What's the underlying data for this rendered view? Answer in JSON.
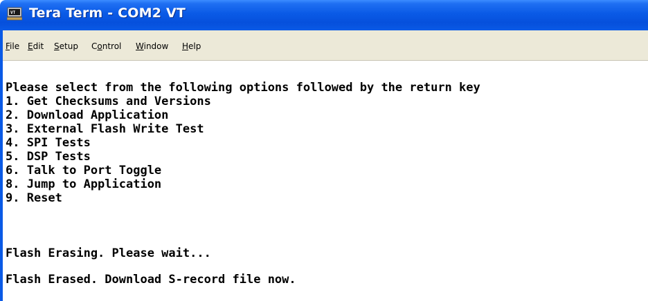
{
  "window": {
    "title": "Tera Term - COM2 VT",
    "icon": "tera-term-app-icon",
    "colors": {
      "titlebar": "#0a5ae6",
      "menubar": "#ece9d8",
      "terminal_bg": "#ffffff",
      "terminal_fg": "#000000"
    }
  },
  "menu": {
    "file": {
      "mnemonic": "F",
      "rest": "ile"
    },
    "edit": {
      "mnemonic": "E",
      "rest": "dit"
    },
    "setup": {
      "mnemonic": "S",
      "rest": "etup"
    },
    "control": {
      "pre": "C",
      "mnemonic": "o",
      "rest": "ntrol"
    },
    "window": {
      "mnemonic": "W",
      "rest": "indow"
    },
    "help": {
      "mnemonic": "H",
      "rest": "elp"
    }
  },
  "terminal": {
    "lines": [
      "Please select from the following options followed by the return key",
      "1. Get Checksums and Versions",
      "2. Download Application",
      "3. External Flash Write Test",
      "4. SPI Tests",
      "5. DSP Tests",
      "6. Talk to Port Toggle",
      "8. Jump to Application",
      "9. Reset",
      "Flash Erasing. Please wait...",
      "Flash Erased. Download S-record file now."
    ]
  }
}
